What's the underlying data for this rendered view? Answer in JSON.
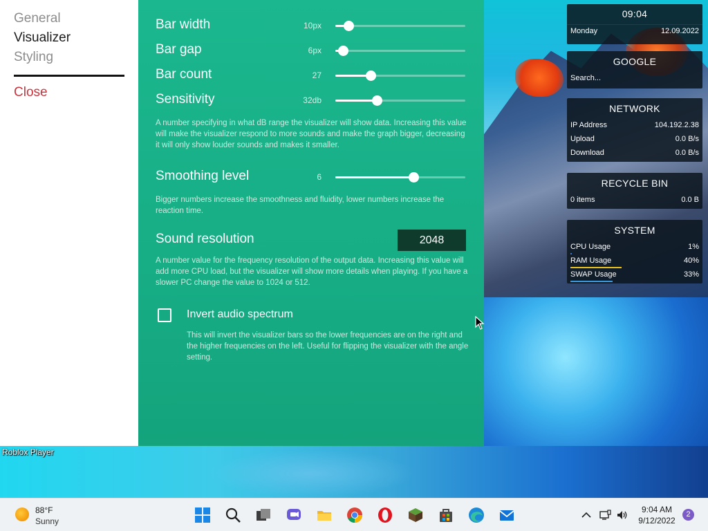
{
  "nav": {
    "general": "General",
    "visualizer": "Visualizer",
    "styling": "Styling",
    "close": "Close"
  },
  "settings": {
    "bar_width": {
      "label": "Bar width",
      "value": "10px",
      "fraction": 0.1
    },
    "bar_gap": {
      "label": "Bar gap",
      "value": "6px",
      "fraction": 0.06
    },
    "bar_count": {
      "label": "Bar count",
      "value": "27",
      "fraction": 0.27
    },
    "sensitivity": {
      "label": "Sensitivity",
      "value": "32db",
      "fraction": 0.32
    },
    "sensitivity_desc": "A number specifying in what dB range the visualizer will show data. Increasing this value will make the visualizer respond to more sounds and make the graph bigger, decreasing it will only show louder sounds and makes it smaller.",
    "smoothing": {
      "label": "Smoothing level",
      "value": "6",
      "fraction": 0.6
    },
    "smoothing_desc": "Bigger numbers increase the smoothness and fluidity, lower numbers increase the reaction time.",
    "sound_resolution": {
      "label": "Sound resolution",
      "value": "2048"
    },
    "sound_resolution_desc": "A number value for the frequency resolution of the output data. Increasing this value will add more CPU load, but the visualizer will show more details when playing. If you have a slower PC change the value to 1024 or 512.",
    "invert": {
      "label": "Invert audio spectrum",
      "checked": false
    },
    "invert_desc": "This will invert the visualizer bars so the lower frequencies are on the right and the higher frequencies on the left. Useful for flipping the visualizer with the angle setting."
  },
  "desktop": {
    "roblox_label": "Roblox Player"
  },
  "widgets": {
    "clock": {
      "time": "09:04",
      "day": "Monday",
      "date": "12.09.2022"
    },
    "google": {
      "title": "GOOGLE",
      "search_placeholder": "Search..."
    },
    "network": {
      "title": "NETWORK",
      "rows": [
        {
          "k": "IP Address",
          "v": "104.192.2.38"
        },
        {
          "k": "Upload",
          "v": "0.0 B/s"
        },
        {
          "k": "Download",
          "v": "0.0 B/s"
        }
      ]
    },
    "recycle": {
      "title": "RECYCLE BIN",
      "items": "0 items",
      "size": "0.0 B"
    },
    "system": {
      "title": "SYSTEM",
      "rows": [
        {
          "k": "CPU Usage",
          "v": "1%",
          "usage": 0.01,
          "color": "#3a7bd5"
        },
        {
          "k": "RAM Usage",
          "v": "40%",
          "usage": 0.4,
          "color": "#e8c020"
        },
        {
          "k": "SWAP Usage",
          "v": "33%",
          "usage": 0.33,
          "color": "#3a9be0"
        }
      ]
    }
  },
  "taskbar": {
    "weather_temp": "88°F",
    "weather_condition": "Sunny",
    "clock_time": "9:04 AM",
    "clock_date": "9/12/2022",
    "notification_count": "2",
    "apps": [
      {
        "name": "start-icon"
      },
      {
        "name": "search-icon"
      },
      {
        "name": "task-view-icon"
      },
      {
        "name": "chat-icon"
      },
      {
        "name": "file-explorer-icon"
      },
      {
        "name": "chrome-icon"
      },
      {
        "name": "opera-icon"
      },
      {
        "name": "minecraft-icon"
      },
      {
        "name": "store-icon"
      },
      {
        "name": "edge-icon"
      },
      {
        "name": "mail-icon"
      }
    ]
  }
}
